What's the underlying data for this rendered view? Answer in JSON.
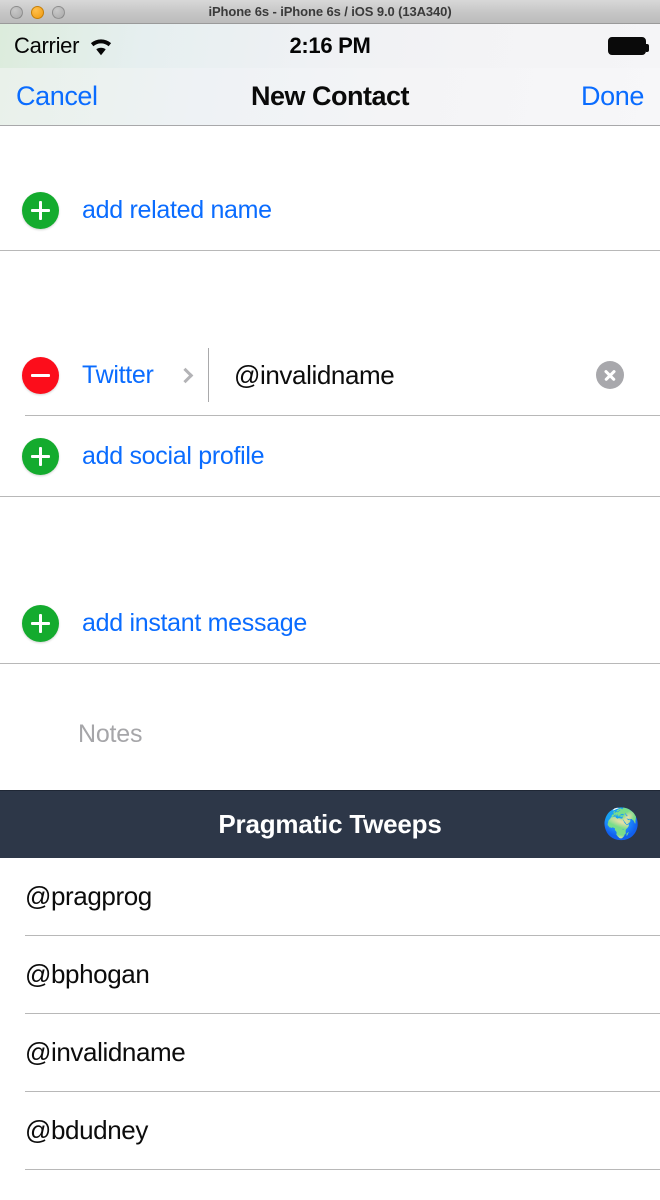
{
  "window": {
    "title": "iPhone 6s - iPhone 6s / iOS 9.0 (13A340)",
    "traffic_lights": [
      "close-button",
      "minimize-button",
      "zoom-button"
    ]
  },
  "status_bar": {
    "carrier": "Carrier",
    "wifi_icon": "wifi-icon",
    "time": "2:16 PM",
    "battery_icon": "battery-full-icon"
  },
  "nav_bar": {
    "cancel_label": "Cancel",
    "title": "New Contact",
    "done_label": "Done"
  },
  "form": {
    "sections": [
      {
        "name": "related-name-section",
        "rows": [
          {
            "type": "add",
            "icon": "plus-circle-icon",
            "label": "add related name"
          }
        ]
      },
      {
        "name": "social-profile-section",
        "rows": [
          {
            "type": "field",
            "icon": "minus-circle-icon",
            "key": "Twitter",
            "disclosure_icon": "chevron-right-icon",
            "value": "@invalidname",
            "clear_icon": "clear-circle-icon"
          },
          {
            "type": "add",
            "icon": "plus-circle-icon",
            "label": "add social profile"
          }
        ]
      },
      {
        "name": "instant-message-section",
        "rows": [
          {
            "type": "add",
            "icon": "plus-circle-icon",
            "label": "add instant message"
          }
        ]
      }
    ],
    "notes": {
      "placeholder": "Notes",
      "value": ""
    }
  },
  "app_bar": {
    "title": "Pragmatic Tweeps",
    "icon": "globe-icon",
    "icon_glyph": "🌍",
    "background_color": "#2d3748"
  },
  "tweep_list": {
    "rows": [
      {
        "handle": "@pragprog"
      },
      {
        "handle": "@bphogan"
      },
      {
        "handle": "@invalidname"
      },
      {
        "handle": "@bdudney"
      }
    ]
  },
  "colors": {
    "ios_blue": "#0a6cff",
    "add_green": "#14ab2e",
    "remove_red": "#fc0d1b",
    "separator": "#b8b8b8",
    "placeholder_gray": "#a6a6a9"
  }
}
